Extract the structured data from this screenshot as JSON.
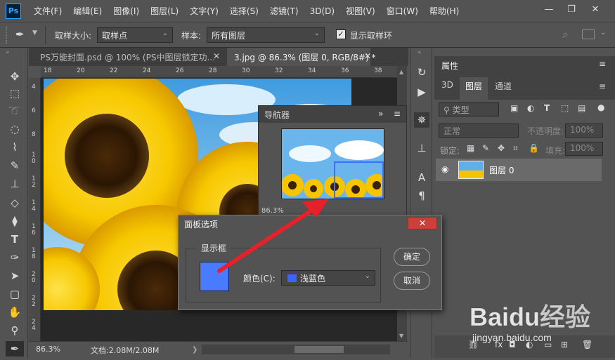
{
  "menu": {
    "logo": "Ps",
    "items": [
      "文件(F)",
      "编辑(E)",
      "图像(I)",
      "图层(L)",
      "文字(Y)",
      "选择(S)",
      "滤镜(T)",
      "3D(D)",
      "视图(V)",
      "窗口(W)",
      "帮助(H)"
    ]
  },
  "options": {
    "sample_size_label": "取样大小:",
    "sample_size_value": "取样点",
    "sample_label": "样本:",
    "sample_value": "所有图层",
    "show_ring_label": "显示取样环",
    "show_ring_checked": true
  },
  "tabs": [
    {
      "label": "PS万能封面.psd @ 100% (PS中图层锁定功...",
      "active": false
    },
    {
      "label": "3.jpg @ 86.3% (图层 0, RGB/8#) *",
      "active": true
    }
  ],
  "ruler_top": [
    "18",
    "20",
    "22",
    "24",
    "26",
    "28",
    "30",
    "32",
    "34",
    "36",
    "38"
  ],
  "ruler_left": [
    "4",
    "6",
    "8",
    "1 0",
    "1 2",
    "1 4",
    "1 6",
    "1 8",
    "2 0",
    "2 2",
    "2 4"
  ],
  "status": {
    "zoom": "86.3%",
    "doc_info": "文档:2.08M/2.08M"
  },
  "navigator": {
    "title": "导航器",
    "zoom": "86.3%"
  },
  "right_panel": {
    "properties_title": "属性",
    "tabs": [
      "3D",
      "图层",
      "通道"
    ],
    "active_tab": "图层",
    "filter_label": "类型",
    "blend_mode": "正常",
    "opacity_label": "不透明度:",
    "opacity_value": "100%",
    "lock_label": "锁定:",
    "fill_label": "填充:",
    "fill_value": "100%",
    "layer_name": "图层 0"
  },
  "dialog": {
    "title": "面板选项",
    "group_label": "显示框",
    "color_label": "颜色(C):",
    "color_value": "浅蓝色",
    "swatch_color": "#4a7bff",
    "ok_label": "确定",
    "cancel_label": "取消"
  },
  "watermark": {
    "brand": "Baidu经验",
    "url": "jingyan.baidu.com"
  },
  "colors": {
    "ui_bg": "#535353",
    "accent_blue": "#3f6fff",
    "arrow_red": "#e8202a"
  },
  "tools": [
    "move-icon",
    "marquee-icon",
    "lasso-icon",
    "quick-select-icon",
    "eyedropper-icon",
    "brush-icon",
    "stamp-icon",
    "eraser-icon",
    "paint-bucket-icon",
    "text-icon",
    "pen-icon",
    "path-select-icon",
    "rectangle-icon",
    "hand-icon",
    "zoom-icon",
    "eyedropper-active-icon"
  ]
}
